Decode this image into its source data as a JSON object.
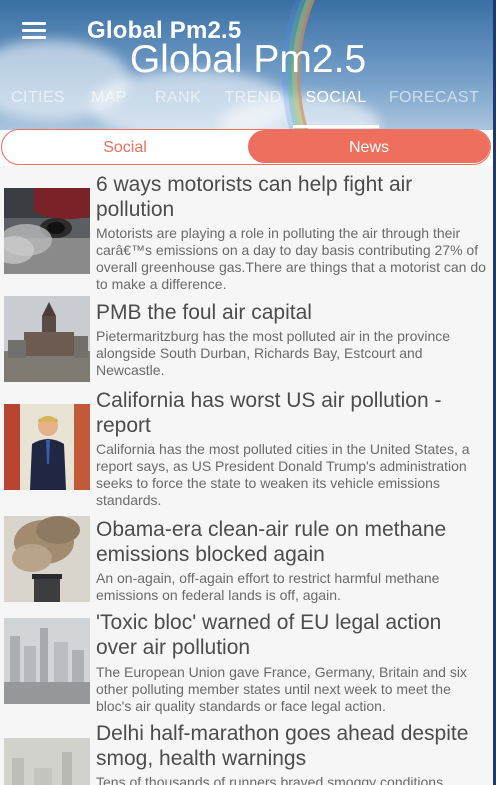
{
  "header": {
    "app_title": "Global Pm2.5",
    "page_title": "Global Pm2.5",
    "tabs": [
      {
        "label": "CITIES"
      },
      {
        "label": "MAP"
      },
      {
        "label": "RANK"
      },
      {
        "label": "TREND"
      },
      {
        "label": "SOCIAL"
      },
      {
        "label": "FORECAST"
      }
    ],
    "active_tab": "SOCIAL"
  },
  "segment": {
    "social_label": "Social",
    "news_label": "News",
    "selected": "News"
  },
  "news": [
    {
      "title": "6 ways motorists can help fight air pollution",
      "description": "Motorists are playing a role in polluting the air through their carâ€™s emissions on a day to day basis contributing 27% of overall greenhouse gas.There are things that a motorist can do to make a difference.",
      "image": "car-exhaust-photo"
    },
    {
      "title": "PMB the foul air capital",
      "description": "Pietermaritzburg has the most polluted air in the province alongside South Durban, Richards Bay, Estcourt and Newcastle.",
      "image": "city-hall-photo"
    },
    {
      "title": "California has worst US air pollution - report",
      "description": "California has the most polluted cities in the United States, a report says, as US President Donald Trump's administration seeks to force the state to weaken its vehicle emissions standards.",
      "image": "man-in-suit-photo"
    },
    {
      "title": "Obama-era clean-air rule on methane emissions blocked again",
      "description": "An on-again, off-again effort to restrict harmful methane emissions on federal lands is off, again.",
      "image": "smokestack-photo"
    },
    {
      "title": "'Toxic bloc' warned of EU legal action over air pollution",
      "description": "The European Union gave France, Germany, Britain and six other polluting member states until next week to meet the bloc's air quality standards or face legal action.",
      "image": "smoggy-city-photo"
    },
    {
      "title": "Delhi half-marathon goes ahead despite smog, health warnings",
      "description": "Tens of thousands of runners braved smoggy conditions",
      "image": "smog-skyline-photo"
    }
  ]
}
